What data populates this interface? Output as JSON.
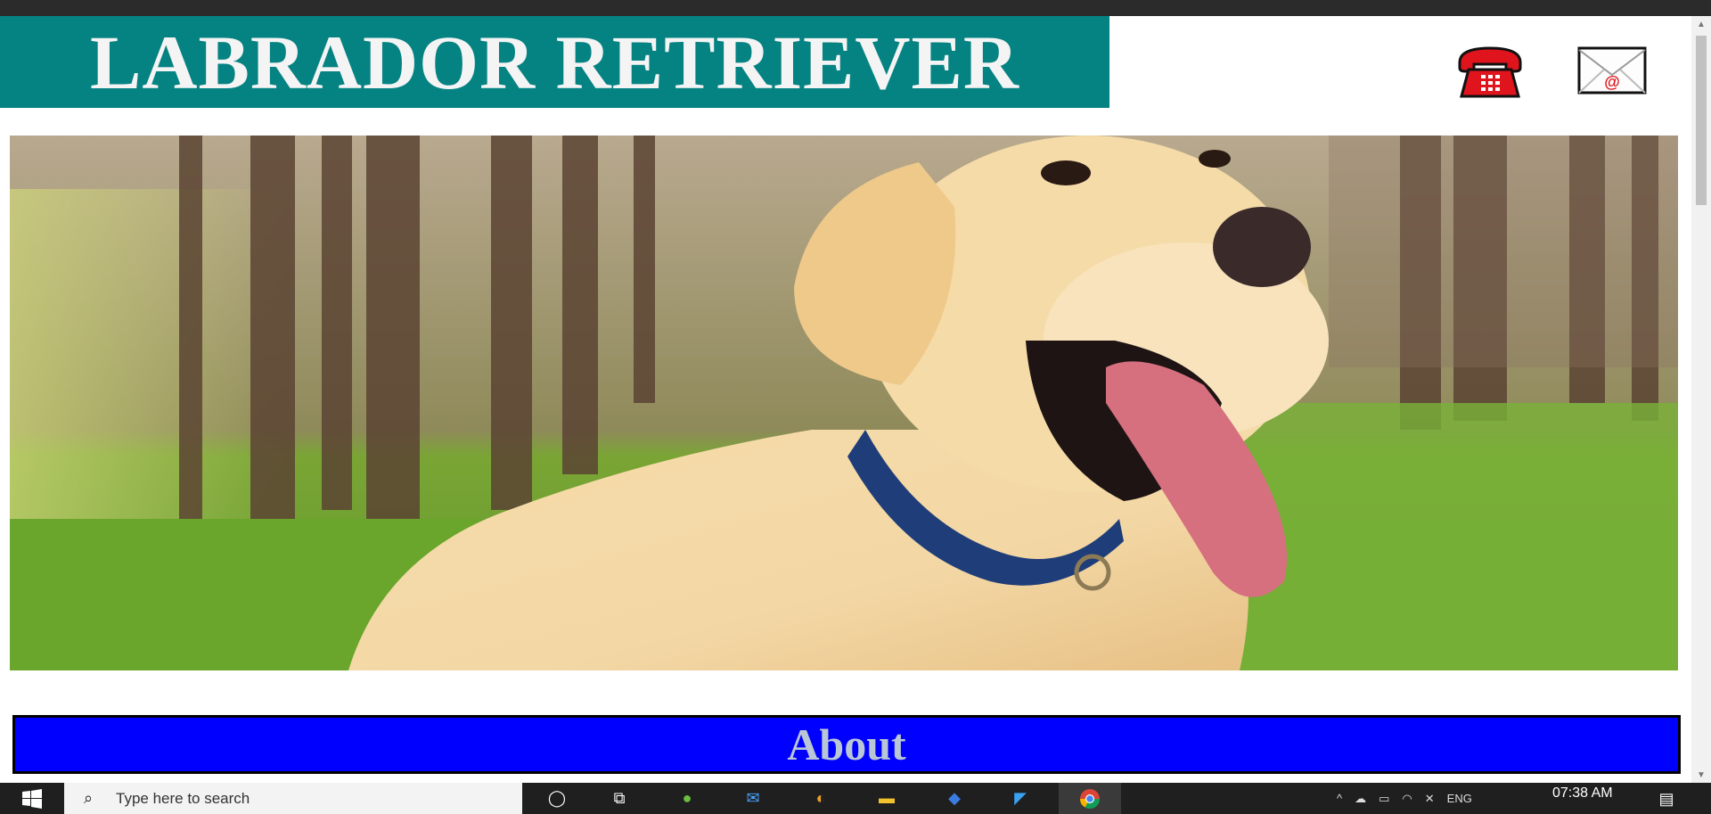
{
  "page": {
    "title": "LABRADOR RETRIEVER",
    "section_heading": "About"
  },
  "icons": {
    "phone": "phone-icon",
    "mail": "mail-icon",
    "mail_symbol": "@"
  },
  "colors": {
    "title_banner": "#058282",
    "about_bar": "#0000ff",
    "phone_red": "#e0141c"
  },
  "taskbar": {
    "search_placeholder": "Type here to search",
    "clock_time": "07:38 AM",
    "language": "ENG"
  }
}
